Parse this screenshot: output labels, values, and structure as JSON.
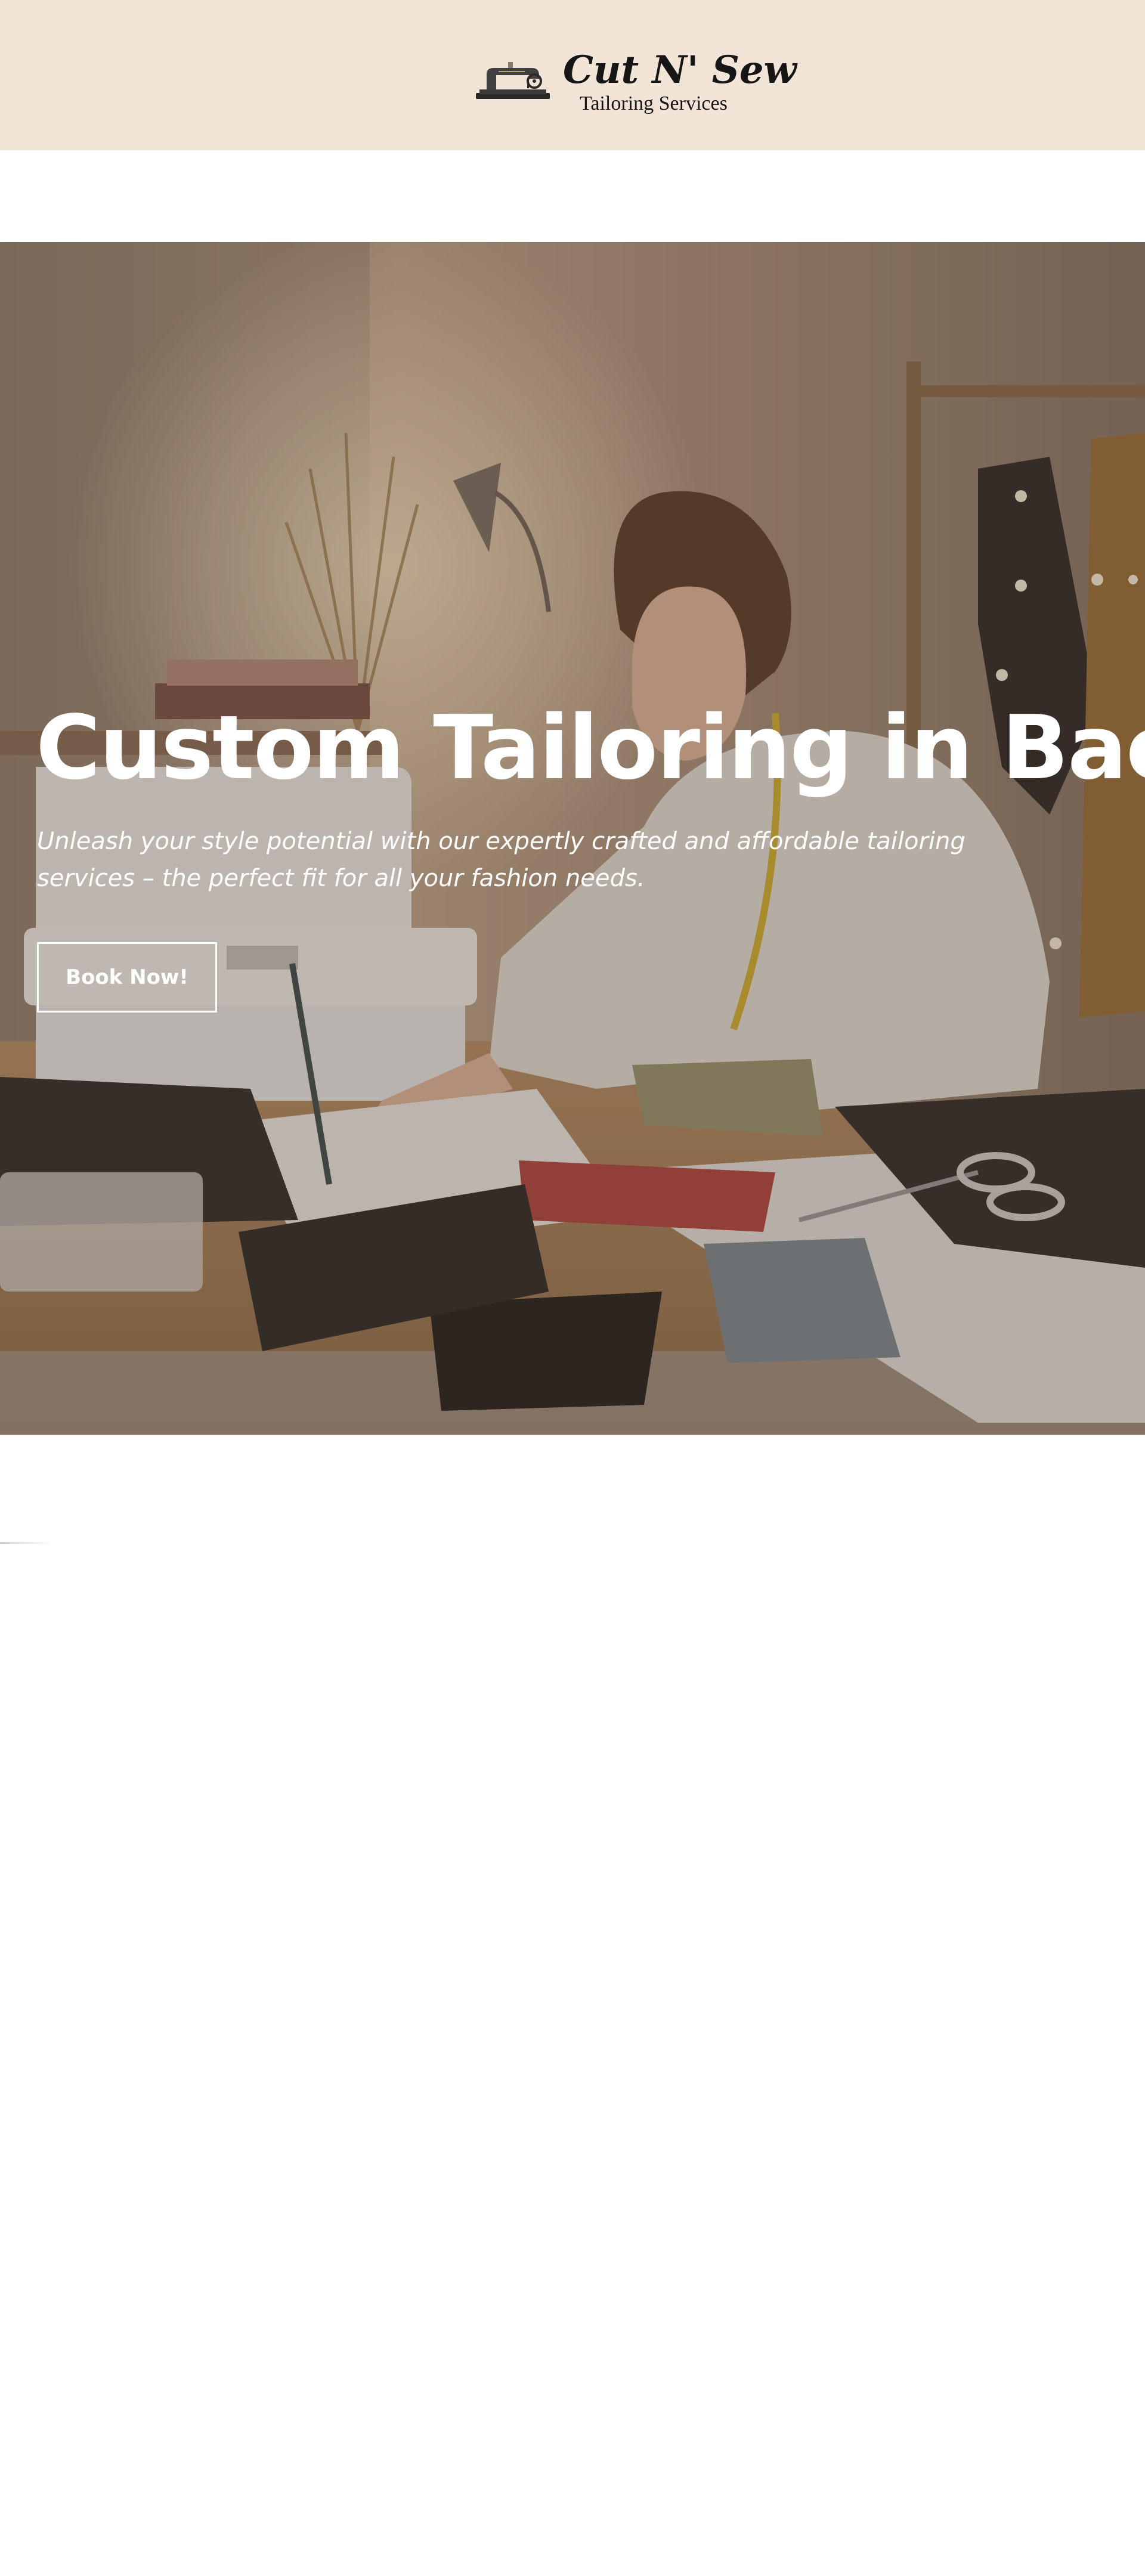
{
  "header": {
    "logo": {
      "wordmark": "Cut N' Sew",
      "tagline": "Tailoring Services",
      "icon": "sewing-machine-icon"
    },
    "background_color": "#f2e4d6"
  },
  "hero": {
    "title": "Custom Tailoring in Bacolod",
    "subtitle": "Unleash your style potential with our expertly crafted and affordable tailoring services – the perfect fit for all your fashion needs.",
    "cta_label": "Book Now!",
    "overlay_tone": "#6b5848"
  }
}
